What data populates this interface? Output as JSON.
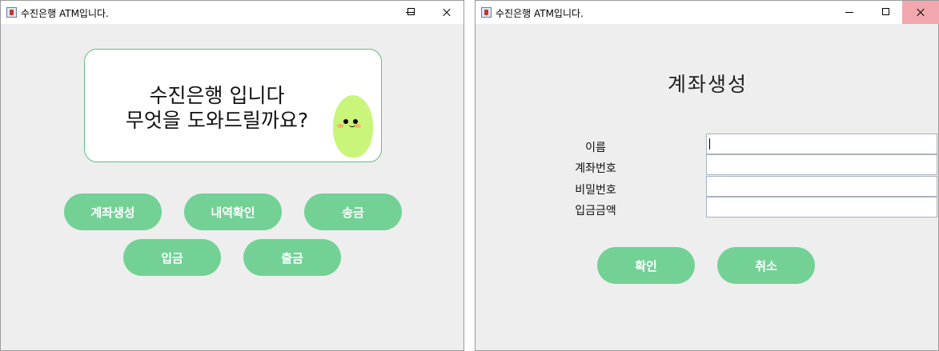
{
  "window_main": {
    "title": "수진은행 ATM입니다.",
    "greeting_line1": "수진은행 입니다",
    "greeting_line2": "무엇을 도와드릴까요?",
    "buttons": {
      "create_account": "계좌생성",
      "history": "내역확인",
      "transfer": "송금",
      "deposit": "입금",
      "withdraw": "출금"
    }
  },
  "window_create": {
    "title": "수진은행 ATM입니다.",
    "heading": "계좌생성",
    "fields": {
      "name_label": "이름",
      "account_label": "계좌번호",
      "password_label": "비밀번호",
      "amount_label": "입금금액",
      "name_value": "",
      "account_value": "",
      "password_value": "",
      "amount_value": ""
    },
    "buttons": {
      "confirm": "확인",
      "cancel": "취소"
    }
  },
  "colors": {
    "button": "#73d196",
    "box_border": "#5fbf83",
    "mascot": "#c9f57a",
    "close_hover": "#f1a7ad"
  },
  "icons": [
    "java-app-icon",
    "minimize-icon",
    "maximize-icon",
    "close-icon",
    "mascot-character"
  ]
}
